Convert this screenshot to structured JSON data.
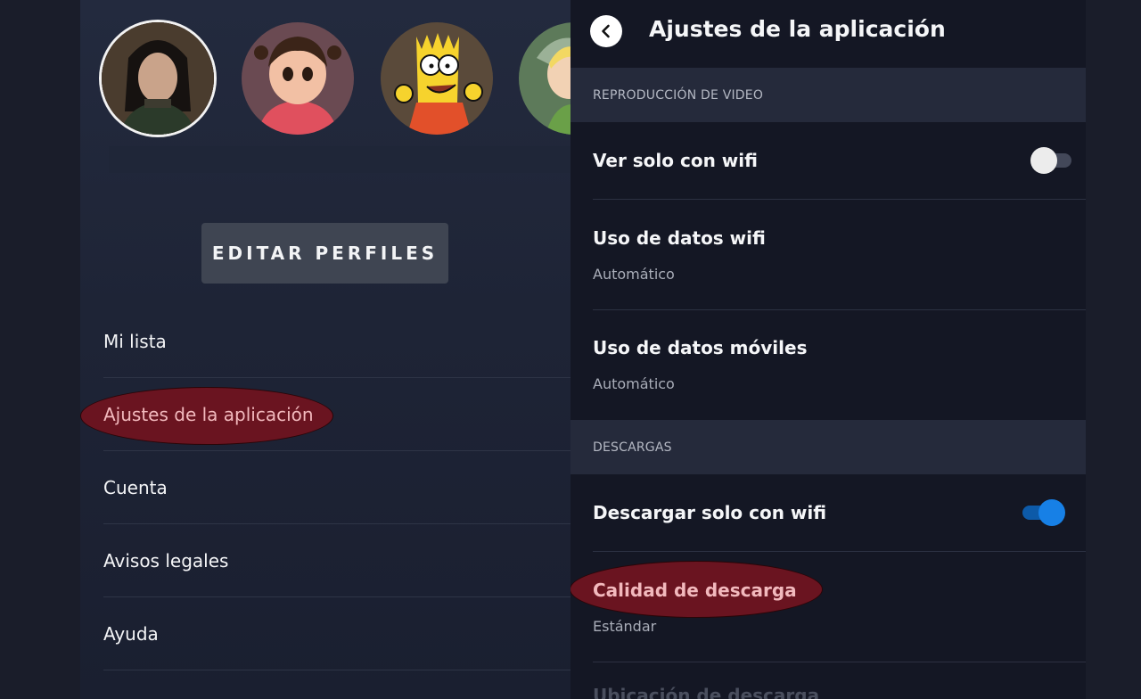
{
  "left": {
    "edit_profiles": "EDITAR PERFILES",
    "menu": [
      {
        "label": "Mi lista"
      },
      {
        "label": "Ajustes de la aplicación"
      },
      {
        "label": "Cuenta"
      },
      {
        "label": "Avisos legales"
      },
      {
        "label": "Ayuda"
      }
    ]
  },
  "right": {
    "title": "Ajustes de la aplicación",
    "sections": {
      "video": "REPRODUCCIÓN DE VIDEO",
      "downloads": "DESCARGAS"
    },
    "rows": {
      "wifi_only": {
        "title": "Ver solo con wifi",
        "toggle": "off"
      },
      "wifi_data": {
        "title": "Uso de datos wifi",
        "value": "Automático"
      },
      "mobile_data": {
        "title": "Uso de datos móviles",
        "value": "Automático"
      },
      "download_wifi": {
        "title": "Descargar solo con wifi",
        "toggle": "on"
      },
      "download_quality": {
        "title": "Calidad de descarga",
        "value": "Estándar"
      },
      "download_location": {
        "title": "Ubicación de descarga"
      }
    }
  },
  "colors": {
    "highlight": "#6a1420",
    "toggle_on": "#1780e6",
    "background": "#141724"
  }
}
